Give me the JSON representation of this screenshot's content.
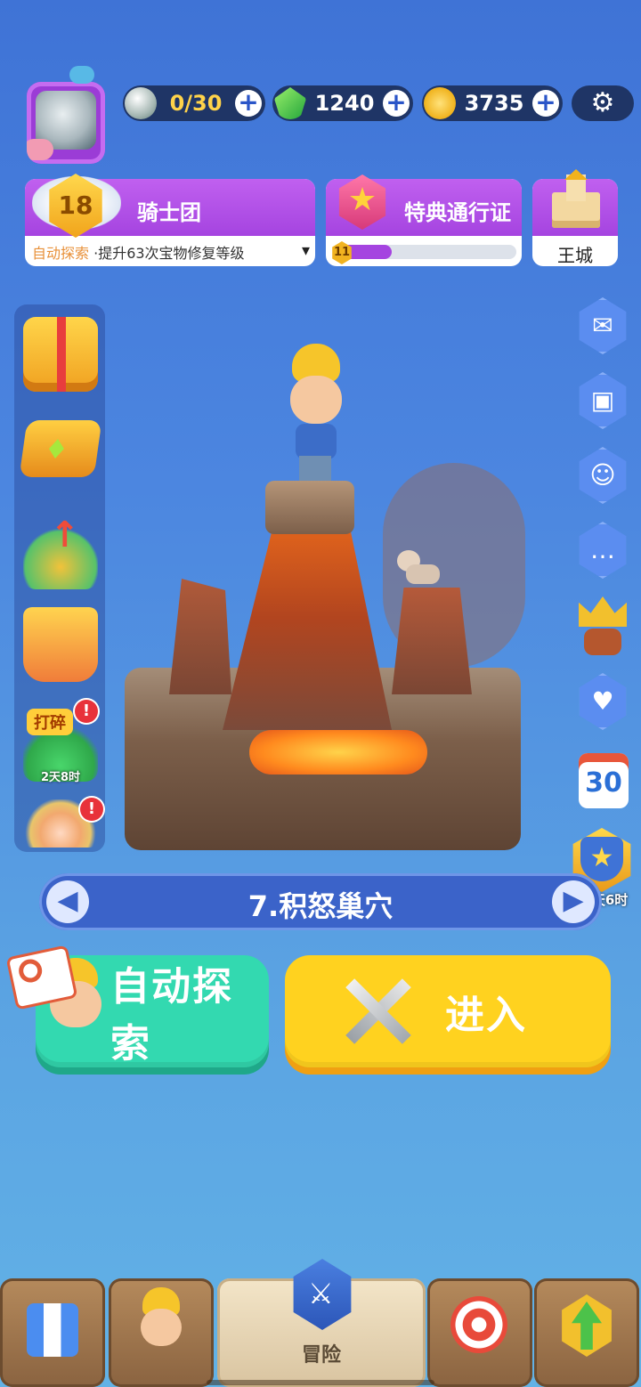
{
  "top_bar": {
    "stones": {
      "value": "0/30",
      "icon": "white-gem-icon"
    },
    "gems": {
      "value": "1240",
      "icon": "green-gem-icon"
    },
    "coins": {
      "value": "3735",
      "icon": "gold-coin-icon"
    },
    "plus": "+",
    "settings_icon": "⚙"
  },
  "knight_banner": {
    "level": "18",
    "title": "骑士团",
    "sub_prefix": "自动探索",
    "sub_text": "·提升63次宝物修复等级",
    "dropdown": "▾"
  },
  "pass_banner": {
    "title": "特典通行证",
    "level": "11",
    "progress": 0.3
  },
  "castle_banner": {
    "label": "王城"
  },
  "left_panel": {
    "shatter_label": "打碎",
    "shatter_timer": "2天8时",
    "alert": "!"
  },
  "right_panel": {
    "calendar_day": "30",
    "rank_timer": "14天6时"
  },
  "level_bar": {
    "name": "7.积怒巢穴",
    "prev": "◀",
    "next": "▶"
  },
  "buttons": {
    "auto_explore": "自动探索",
    "enter": "进入"
  },
  "bottom_nav": {
    "adventure": "冒险"
  },
  "colors": {
    "auto_button": "#33d9b0",
    "enter_button": "#ffd21f"
  }
}
